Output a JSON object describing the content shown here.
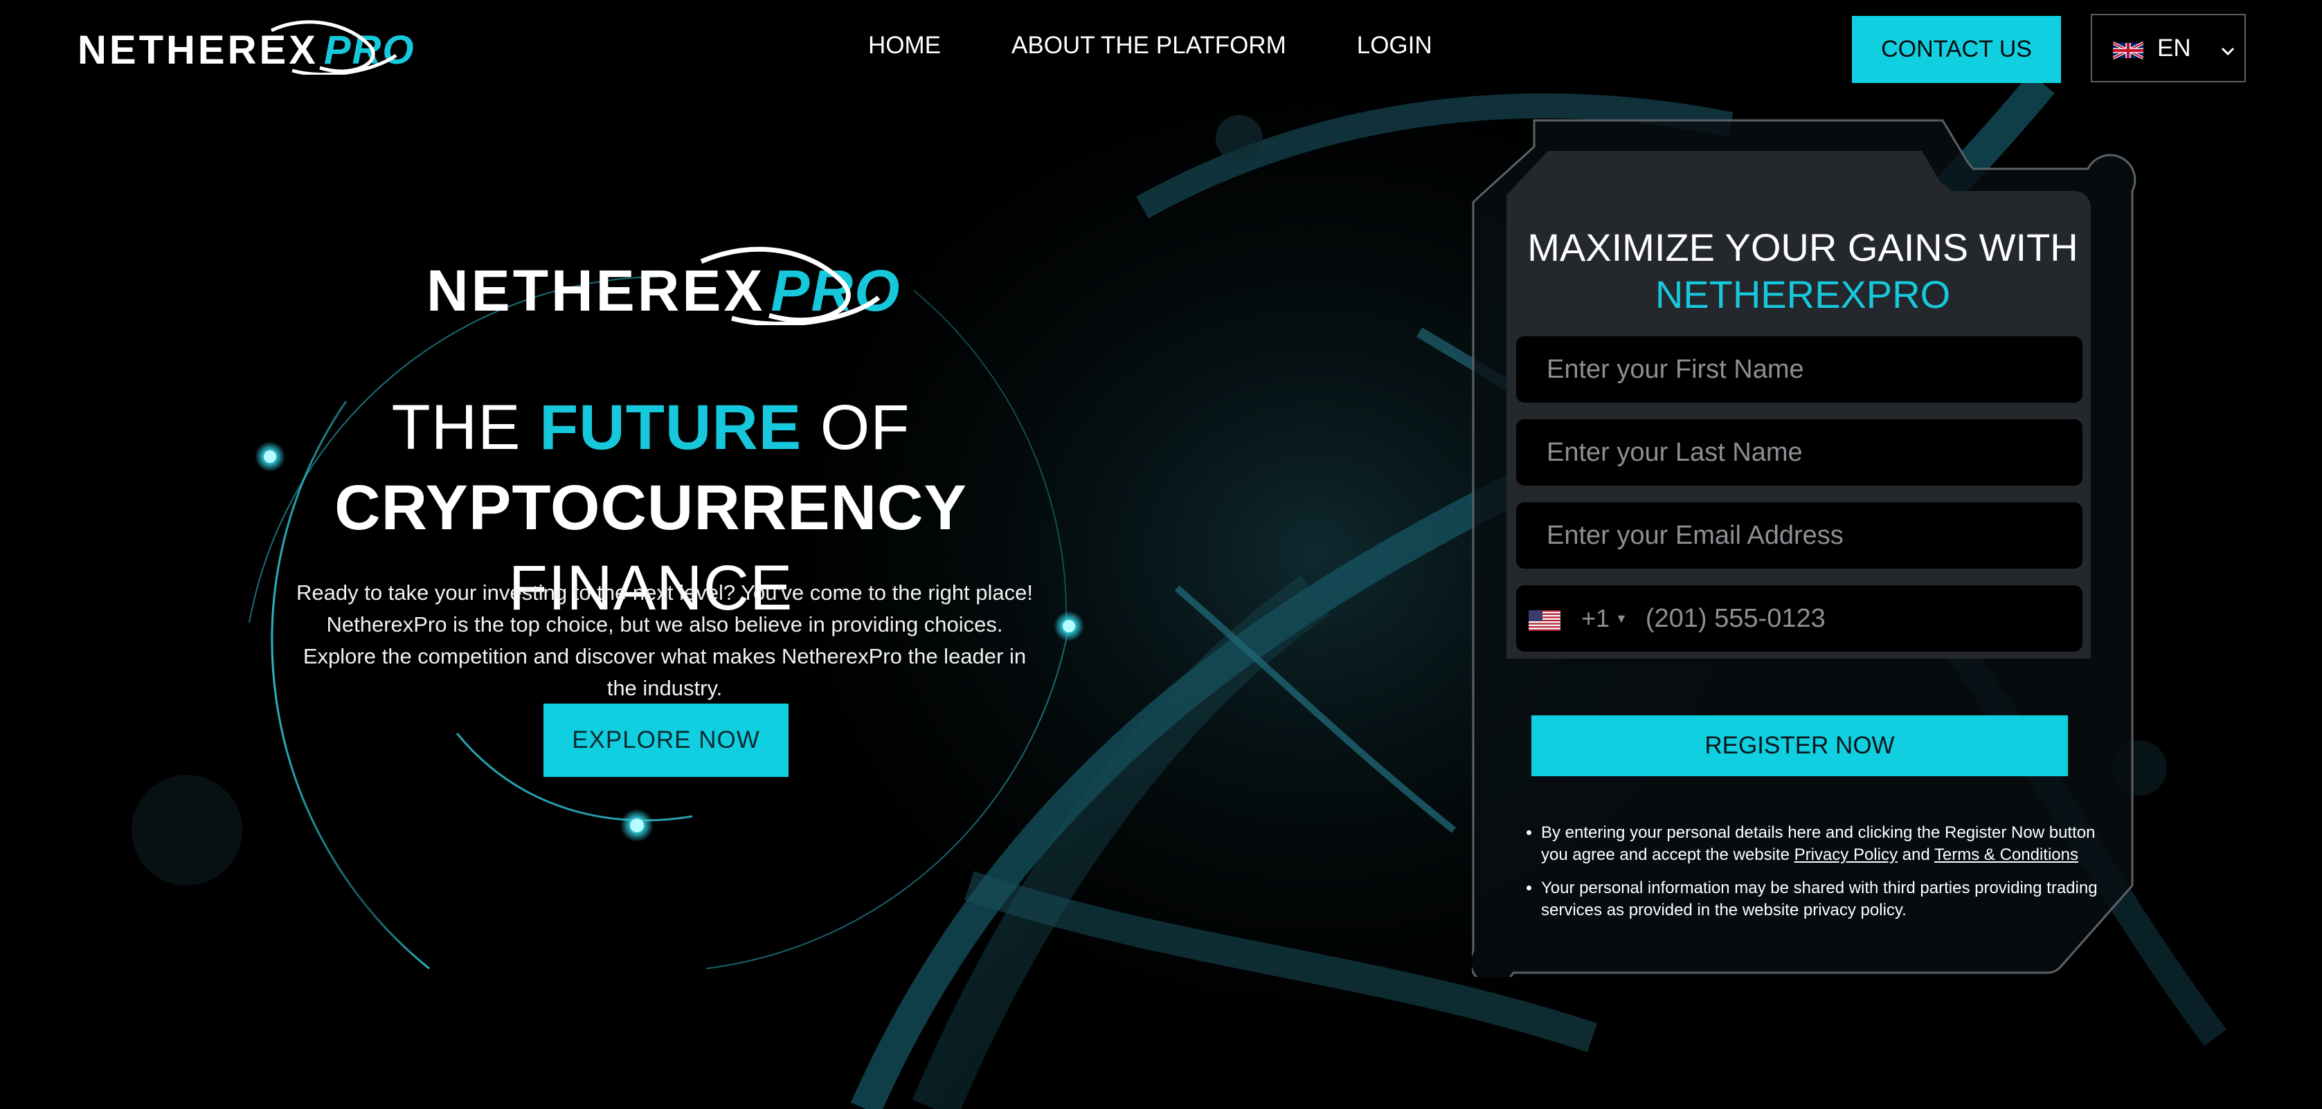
{
  "brand": {
    "name": "NETHEREX",
    "suffix": "PRO"
  },
  "nav": {
    "items": [
      {
        "label": "HOME"
      },
      {
        "label": "ABOUT THE PLATFORM"
      },
      {
        "label": "LOGIN"
      }
    ],
    "contact_label": "CONTACT US",
    "language": {
      "selected": "EN",
      "flag": "uk-flag-icon"
    }
  },
  "hero": {
    "title_line1_a": "THE",
    "title_line1_accent": "FUTURE",
    "title_line1_b": "OF",
    "title_line2_bold": "CRYPTOCURRENCY",
    "title_line2_thin": "FINANCE",
    "description": "Ready to take your investing to the next level? You've come to the right place! NetherexPro is the top choice, but we also believe in providing choices. Explore the competition and discover what makes NetherexPro the leader in the industry.",
    "cta_label": "EXPLORE NOW"
  },
  "form": {
    "title_line1": "MAXIMIZE YOUR GAINS WITH",
    "title_line2": "NETHEREXPRO",
    "first_name_placeholder": "Enter your First Name",
    "last_name_placeholder": "Enter your Last Name",
    "email_placeholder": "Enter your Email Address",
    "phone": {
      "country_flag": "us-flag-icon",
      "dial_code": "+1",
      "placeholder": "(201) 555-0123"
    },
    "submit_label": "REGISTER NOW",
    "disclaimer_1_text": "By entering your personal details here and clicking the Register Now button you agree and accept the website",
    "privacy_link": "Privacy Policy",
    "and_text": "and",
    "terms_link": "Terms & Conditions",
    "disclaimer_2_text": "Your personal information may be shared with third parties providing trading services as provided in the website privacy policy."
  },
  "colors": {
    "accent": "#10cfe0",
    "background": "#000000",
    "panel": "#24272c"
  }
}
